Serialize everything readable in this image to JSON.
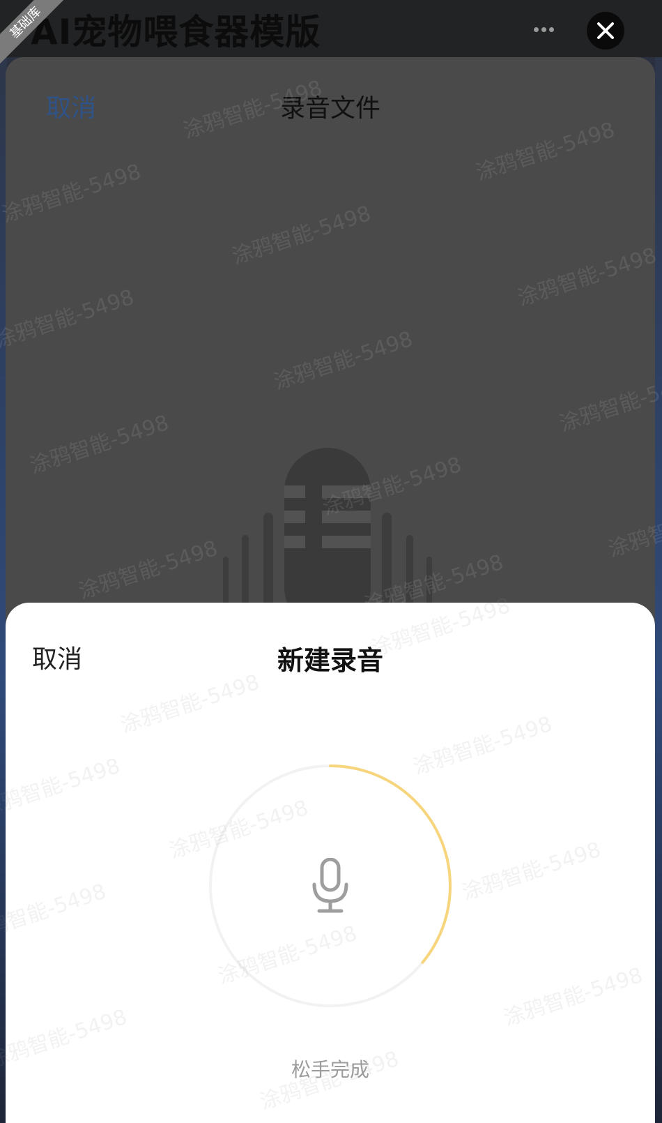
{
  "app_bar": {
    "title": "AI宠物喂食器模版",
    "ribbon": "基础库",
    "more_icon": "more-dots-icon",
    "close_icon": "close-icon"
  },
  "recording_sheet": {
    "cancel": "取消",
    "title": "录音文件",
    "cancel_color": "#2f5386"
  },
  "watermark": "涂鸦智能-5498",
  "new_recording": {
    "cancel": "取消",
    "title": "新建录音",
    "hint": "松手完成",
    "progress": 0.36,
    "ring_color": "#f7d57c",
    "mic_icon": "microphone-icon"
  }
}
